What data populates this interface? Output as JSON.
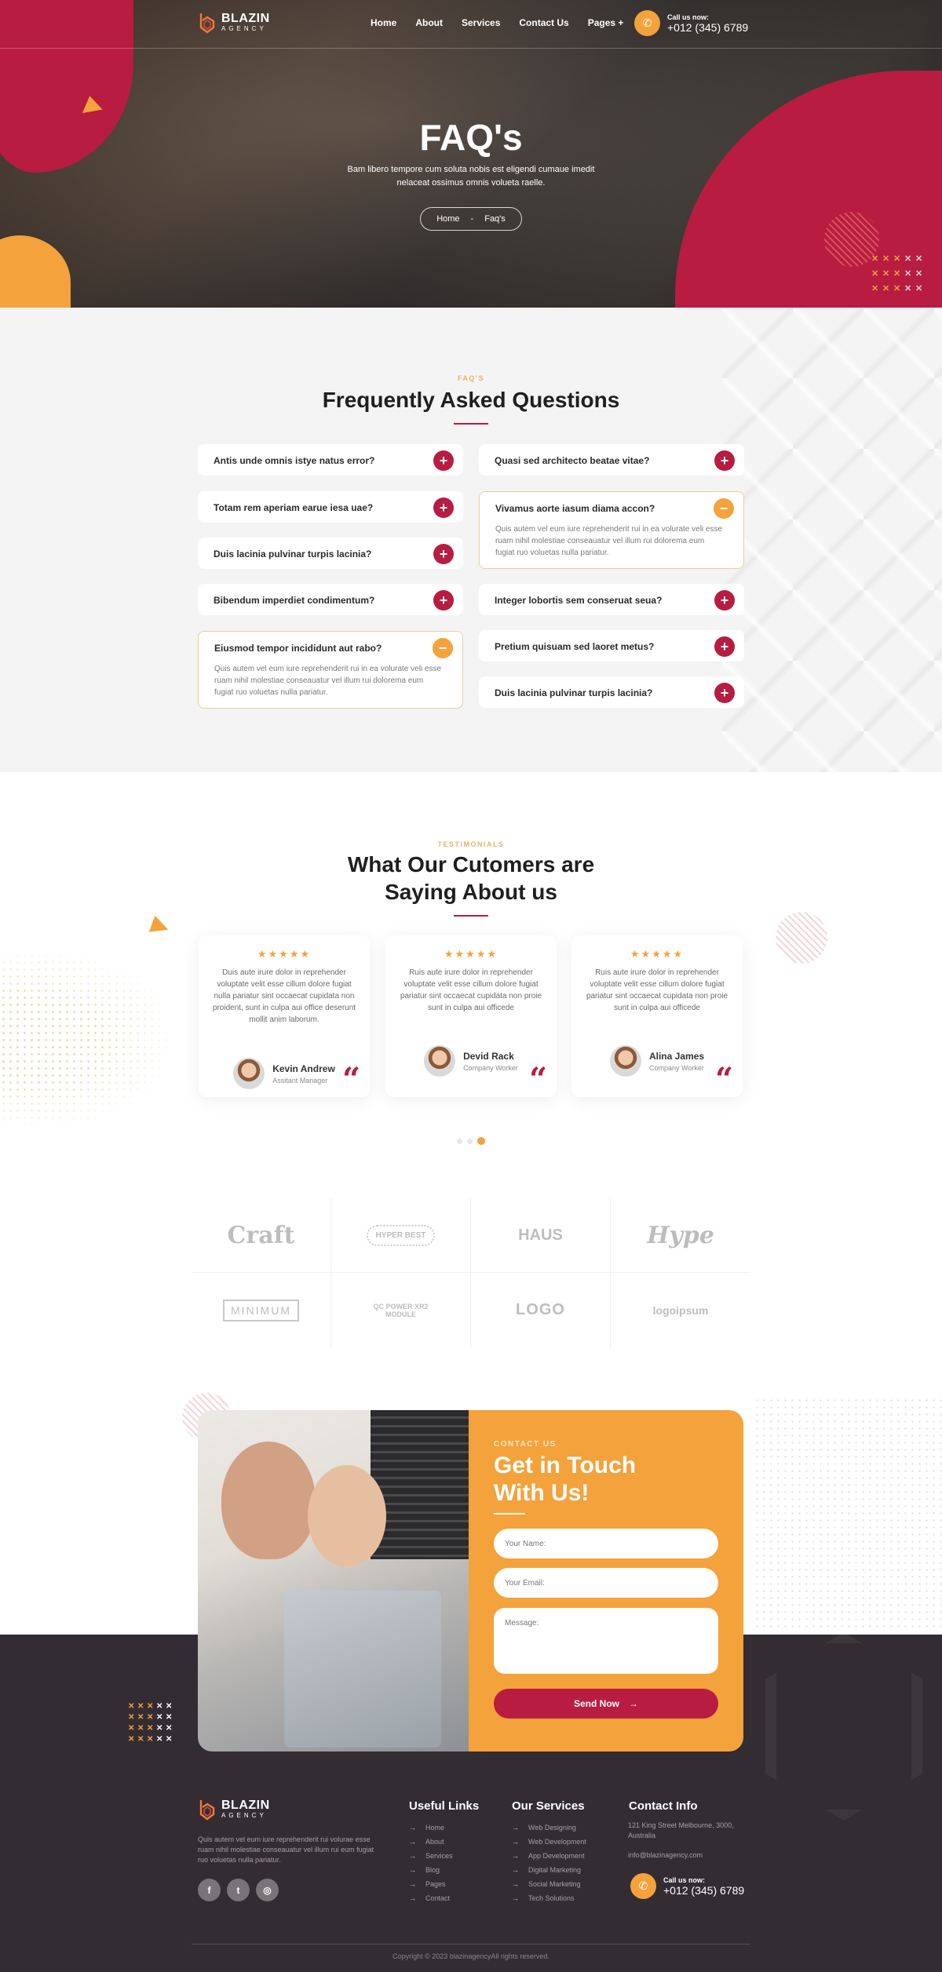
{
  "brand": {
    "name": "BLAZIN",
    "sub": "AGENCY"
  },
  "nav": {
    "items": [
      "Home",
      "About",
      "Services",
      "Contact Us",
      "Pages +"
    ]
  },
  "call": {
    "label": "Call us now:",
    "number": "+012 (345) 6789"
  },
  "hero": {
    "title": "FAQ's",
    "subtitle": "Bam libero tempore cum soluta nobis est eligendi cumaue imedit nelaceat ossimus omnis volueta raelle.",
    "breadcrumb": {
      "home": "Home",
      "sep": "-",
      "current": "Faq's"
    }
  },
  "faq": {
    "eyebrow": "FAQ'S",
    "title": "Frequently Asked Questions",
    "answer_text": "Quis autem vel eum iure reprehenderit rui in ea volurate veli esse ruam nihil molestiae conseauatur vel illum rui dolorema eum fugiat ruo voluetas nulla pariatur.",
    "left": [
      {
        "q": "Antis unde omnis istye natus error?",
        "open": false
      },
      {
        "q": "Totam rem aperiam earue iesa uae?",
        "open": false
      },
      {
        "q": "Duis lacinia pulvinar turpis lacinia?",
        "open": false
      },
      {
        "q": "Bibendum imperdiet condimentum?",
        "open": false
      },
      {
        "q": "Eiusmod tempor incididunt aut rabo?",
        "open": true
      }
    ],
    "right": [
      {
        "q": "Quasi sed architecto beatae vitae?",
        "open": false
      },
      {
        "q": "Vivamus aorte iasum diama accon?",
        "open": true
      },
      {
        "q": "Integer lobortis sem conseruat seua?",
        "open": false
      },
      {
        "q": "Pretium quisuam sed laoret metus?",
        "open": false
      },
      {
        "q": "Duis lacinia pulvinar turpis lacinia?",
        "open": false
      }
    ],
    "plus": "+",
    "minus": "−"
  },
  "testimonials": {
    "eyebrow": "TESTIMONIALS",
    "title_line1": "What Our Cutomers are",
    "title_line2": "Saying About us",
    "stars": "★★★★★",
    "rating": 5,
    "quote_glyph": "“",
    "items": [
      {
        "text": "Duis aute irure dolor in reprehender voluptate velit esse cillum dolore fugiat nulla pariatur sint occaecat cupidata non proident, sunt in culpa aui office deserunt mollit anim laborum.",
        "name": "Kevin Andrew",
        "role": "Assitant Manager"
      },
      {
        "text": "Ruis aute irure dolor in reprehender voluptate velit esse cillum dolore fugiat pariatur sint occaecat cupidata non proie sunt in culpa aui officede",
        "name": "Devid Rack",
        "role": "Company Worker"
      },
      {
        "text": "Ruis aute irure dolor in reprehender voluptate velit esse cillum dolore fugiat pariatur sint occaecat cupidata non proie sunt in culpa aui officede",
        "name": "Alina James",
        "role": "Company Worker"
      }
    ],
    "pager": {
      "pages": 3,
      "active": 3
    }
  },
  "brands": [
    "Craft",
    "HYPER BEST",
    "HAUS",
    "Hype",
    "MINIMUM",
    "QC POWER XR2 MODULE",
    "LOGO",
    "logoipsum"
  ],
  "contact": {
    "eyebrow": "CONTACT US",
    "title_line1": "Get in Touch",
    "title_line2": "With Us!",
    "name_placeholder": "Your Name:",
    "email_placeholder": "Your Email:",
    "message_placeholder": "Message:",
    "send_label": "Send Now",
    "send_icon": "→"
  },
  "footer": {
    "about": "Quis autem vel eum iure reprehenderit rui volurae esse ruam nihil molestiae conseauatur vel illum rui eum fugiat ruo voluetas nulla pariatur.",
    "social": [
      "f",
      "t",
      "◎"
    ],
    "useful_title": "Useful Links",
    "useful": [
      "Home",
      "About",
      "Services",
      "Blog",
      "Pages",
      "Contact"
    ],
    "services_title": "Our Services",
    "services": [
      "Web Designing",
      "Web Development",
      "App Development",
      "Digital Marketing",
      "Social Marketing",
      "Tech Solutions"
    ],
    "contact_title": "Contact Info",
    "address_line1": "121 King Street Melbourne, 3000,",
    "address_line2": "Australia",
    "email": "info@blazinagency.com",
    "arrow": "→",
    "copyright": "Copyright © 2023 blazinagencyAll rights reserved."
  },
  "colors": {
    "primary": "#b81c41",
    "accent": "#f4a23c",
    "footer_bg": "#332d33"
  }
}
